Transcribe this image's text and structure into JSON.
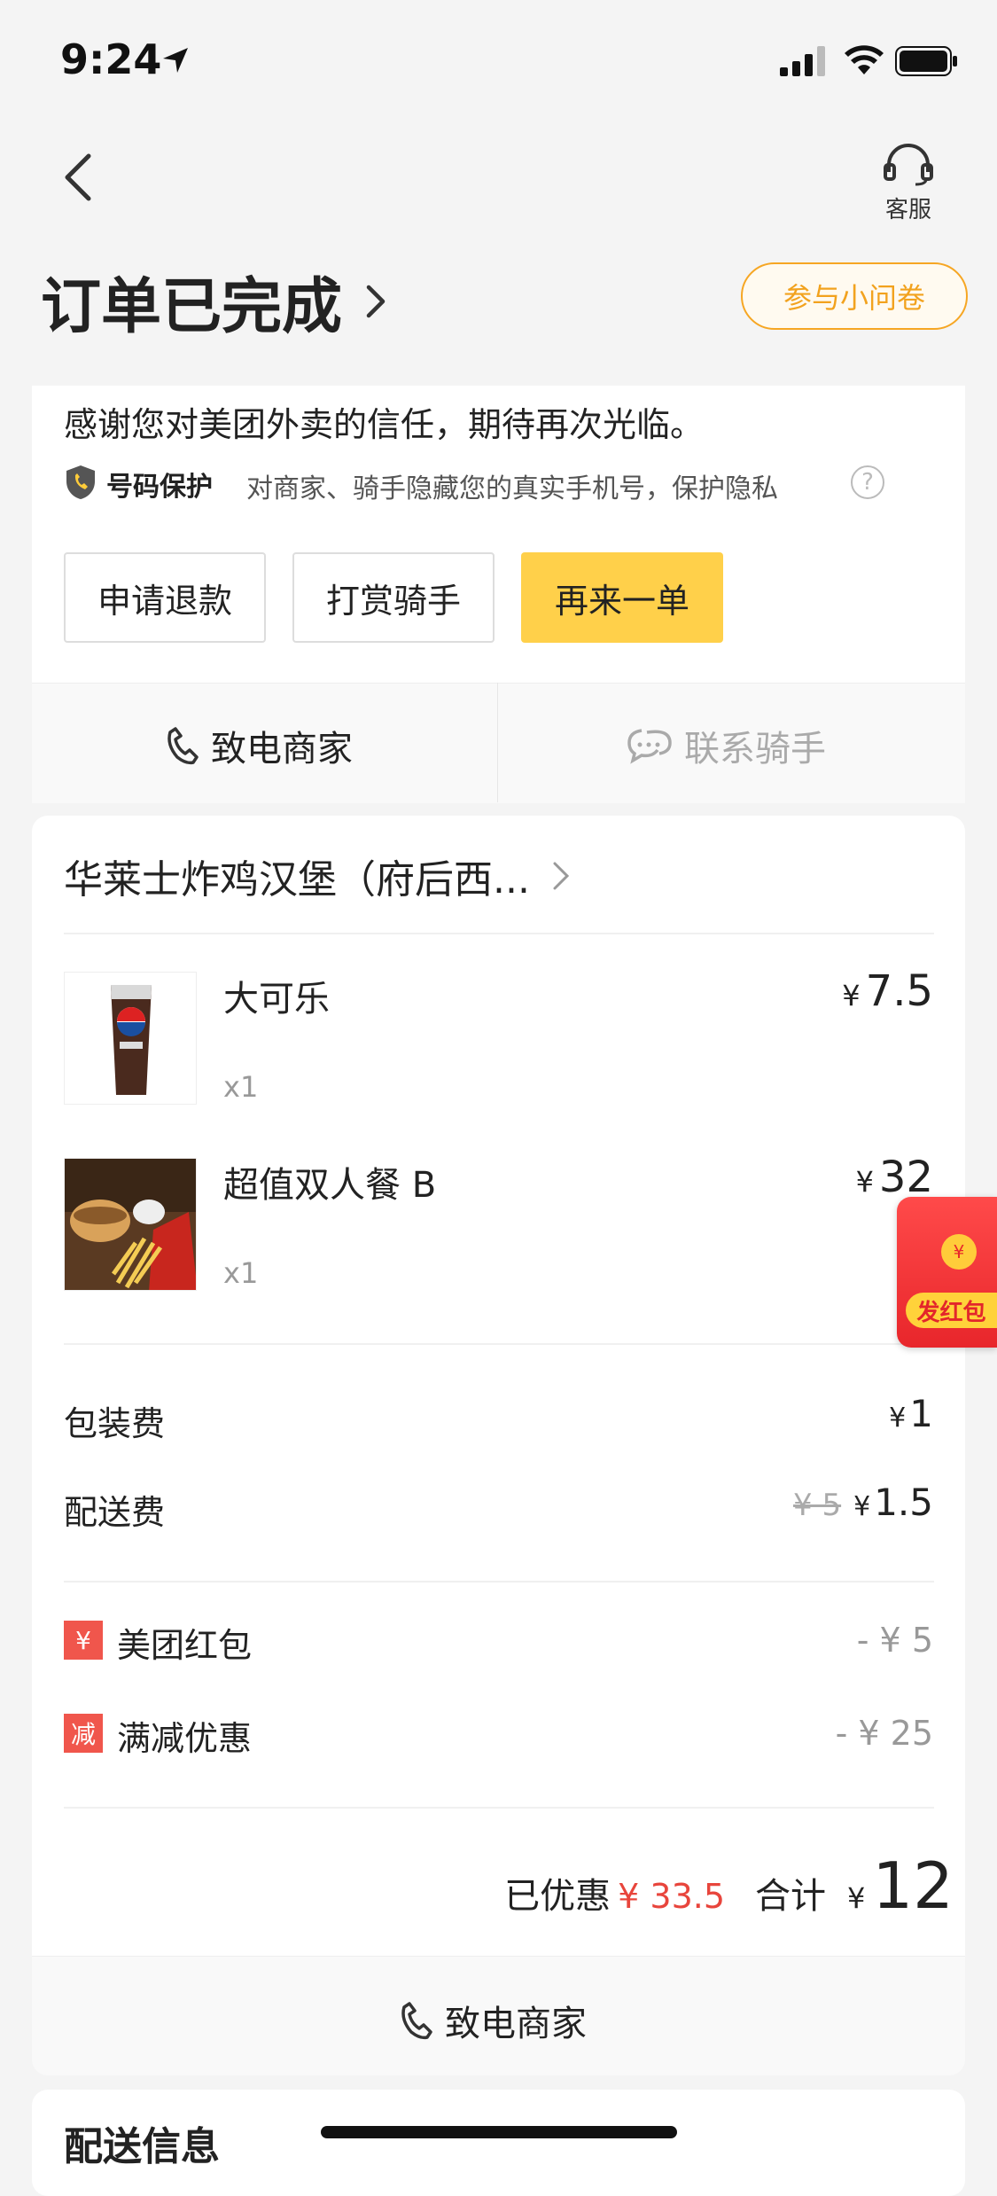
{
  "status_bar": {
    "time": "9:24"
  },
  "header": {
    "customer_service_label": "客服"
  },
  "order": {
    "status_title": "订单已完成",
    "survey_button": "参与小问卷"
  },
  "info": {
    "thanks_text": "感谢您对美团外卖的信任，期待再次光临。",
    "privacy_title": "号码保护",
    "privacy_text": "对商家、骑手隐藏您的真实手机号，保护隐私",
    "help_icon": "?"
  },
  "actions": {
    "refund": "申请退款",
    "tip_rider": "打赏骑手",
    "reorder": "再来一单"
  },
  "contact": {
    "call_merchant": "致电商家",
    "contact_rider": "联系骑手"
  },
  "shop": {
    "name": "华莱士炸鸡汉堡（府后西..."
  },
  "items": [
    {
      "name": "大可乐",
      "qty": "x1",
      "currency": "¥",
      "price": "7.5"
    },
    {
      "name": "超值双人餐 B",
      "qty": "x1",
      "currency": "¥",
      "price": "32"
    }
  ],
  "fees": {
    "packaging_label": "包装费",
    "packaging_currency": "¥",
    "packaging_value": "1",
    "delivery_label": "配送费",
    "delivery_original": "¥ 5",
    "delivery_currency": "¥",
    "delivery_value": "1.5"
  },
  "discounts": {
    "redpacket_tag": "¥",
    "redpacket_label": "美团红包",
    "redpacket_value": "- ¥ 5",
    "fullcut_tag": "减",
    "fullcut_label": "满减优惠",
    "fullcut_value": "- ¥ 25"
  },
  "summary": {
    "saved_label": "已优惠",
    "saved_value": "¥ 33.5",
    "total_label": "合计",
    "total_currency": "¥",
    "total_value": "12"
  },
  "bottom": {
    "call_merchant": "致电商家",
    "delivery_info": "配送信息"
  },
  "floating": {
    "redpacket_label": "发红包",
    "coin": "¥"
  },
  "colors": {
    "accent": "#ffd04a",
    "survey": "#f6a623",
    "red": "#e8453c"
  }
}
